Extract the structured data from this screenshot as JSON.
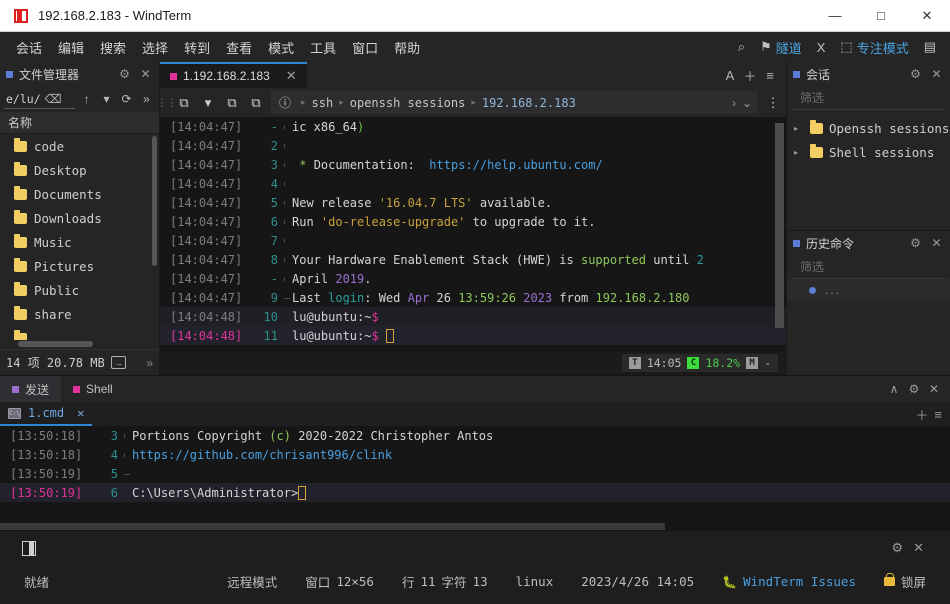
{
  "window": {
    "title": "192.168.2.183 - WindTerm",
    "minimize": "—",
    "maximize": "□",
    "close": "✕"
  },
  "menubar": {
    "items": [
      "会话",
      "编辑",
      "搜索",
      "选择",
      "转到",
      "查看",
      "模式",
      "工具",
      "窗口",
      "帮助"
    ],
    "right": {
      "search_icon": "⌕",
      "tunnel_icon": "⚑",
      "tunnel_label": "隧道",
      "x_label": "X",
      "focus_icon": "⬚",
      "focus_label": "专注模式",
      "layout_icon": "▤"
    }
  },
  "filemanager": {
    "title": "文件管理器",
    "gear_icon": "⚙",
    "close_icon": "✕",
    "path_value": "e/lu/",
    "clear_icon": "⌫",
    "up_icon": "↑",
    "dropdown_icon": "▾",
    "refresh_icon": "⟳",
    "more_icon": "»",
    "column_header": "名称",
    "items": [
      {
        "name": "code"
      },
      {
        "name": "Desktop"
      },
      {
        "name": "Documents"
      },
      {
        "name": "Downloads"
      },
      {
        "name": "Music"
      },
      {
        "name": "Pictures"
      },
      {
        "name": "Public"
      },
      {
        "name": "share"
      }
    ],
    "status": "14 项 20.78 MB",
    "transfer_icon": "→",
    "status_more": "»"
  },
  "terminal": {
    "tab": {
      "label": "1.192.168.2.183",
      "close_icon": "✕",
      "font_icon": "A",
      "add_icon": "＋",
      "menu_icon": "≡"
    },
    "toolbar": {
      "new_icon": "⧉",
      "dropdown_icon": "▾",
      "close_tab_icon": "⧉",
      "dup_icon": "⧉",
      "info_icon": "ⓘ",
      "crumbs": [
        "ssh",
        "openssh sessions",
        "192.168.2.183"
      ],
      "sep": "▸",
      "chevron_right": "›",
      "chevron_down": "⌄",
      "more_icon": "⋮"
    },
    "lines": [
      {
        "ts": "[14:04:47]",
        "ln": "-",
        "bar": "v",
        "spans": [
          {
            "t": "ic x86_64",
            "c": "c-white"
          },
          {
            "t": ")",
            "c": "c-green"
          }
        ]
      },
      {
        "ts": "[14:04:47]",
        "ln": "2",
        "bar": "v",
        "spans": []
      },
      {
        "ts": "[14:04:47]",
        "ln": "3",
        "bar": "v",
        "spans": [
          {
            "t": " ",
            "c": "c-white"
          },
          {
            "t": "*",
            "c": "c-lgreen"
          },
          {
            "t": " Documentation:  ",
            "c": "c-white"
          },
          {
            "t": "https://help.ubuntu.com/",
            "c": "c-blue"
          }
        ]
      },
      {
        "ts": "[14:04:47]",
        "ln": "4",
        "bar": "v",
        "spans": []
      },
      {
        "ts": "[14:04:47]",
        "ln": "5",
        "bar": "v",
        "spans": [
          {
            "t": "New release ",
            "c": "c-white"
          },
          {
            "t": "'16.04.7 LTS'",
            "c": "c-yellow"
          },
          {
            "t": " available.",
            "c": "c-white"
          }
        ]
      },
      {
        "ts": "[14:04:47]",
        "ln": "6",
        "bar": "v",
        "spans": [
          {
            "t": "Run ",
            "c": "c-white"
          },
          {
            "t": "'do-release-upgrade'",
            "c": "c-yellow"
          },
          {
            "t": " to upgrade to it.",
            "c": "c-white"
          }
        ]
      },
      {
        "ts": "[14:04:47]",
        "ln": "7",
        "bar": "v",
        "spans": []
      },
      {
        "ts": "[14:04:47]",
        "ln": "8",
        "bar": "v",
        "spans": [
          {
            "t": "Your Hardware Enablement Stack (HWE) is ",
            "c": "c-white"
          },
          {
            "t": "supported",
            "c": "c-lgreen"
          },
          {
            "t": " until ",
            "c": "c-white"
          },
          {
            "t": "2",
            "c": "c-cyan"
          }
        ]
      },
      {
        "ts": "[14:04:47]",
        "ln": "-",
        "bar": "v",
        "spans": [
          {
            "t": "April ",
            "c": "c-white"
          },
          {
            "t": "2019",
            "c": "c-purple"
          },
          {
            "t": ".",
            "c": "c-white"
          }
        ]
      },
      {
        "ts": "[14:04:47]",
        "ln": "9",
        "bar": "end",
        "spans": [
          {
            "t": "Last ",
            "c": "c-white"
          },
          {
            "t": "login",
            "c": "c-cyan"
          },
          {
            "t": ": Wed ",
            "c": "c-white"
          },
          {
            "t": "Apr",
            "c": "c-purple"
          },
          {
            "t": " 26 ",
            "c": "c-white"
          },
          {
            "t": "13:59:26",
            "c": "c-lgreen"
          },
          {
            "t": " ",
            "c": "c-white"
          },
          {
            "t": "2023",
            "c": "c-purple"
          },
          {
            "t": " from ",
            "c": "c-white"
          },
          {
            "t": "192.168.2.180",
            "c": "c-lgreen"
          }
        ]
      },
      {
        "ts": "[14:04:48]",
        "ln": "10",
        "bar": "",
        "state": "sel",
        "spans": [
          {
            "t": "lu@ubuntu:~",
            "c": "c-white"
          },
          {
            "t": "$",
            "c": "c-pink"
          }
        ]
      },
      {
        "ts": "[14:04:48]",
        "ln": "11",
        "bar": "",
        "state": "cur",
        "spans": [
          {
            "t": "lu@ubuntu:~",
            "c": "c-white"
          },
          {
            "t": "$ ",
            "c": "c-pink"
          }
        ],
        "cursor": true
      }
    ],
    "status": {
      "t_chip": "T",
      "time": "14:05",
      "c_chip": "C",
      "cpu": "18.2%",
      "m_chip": "M",
      "mem": "-"
    }
  },
  "sessions": {
    "title": "会话",
    "gear_icon": "⚙",
    "close_icon": "✕",
    "filter_placeholder": "筛选",
    "arrow_icon": "▸",
    "items": [
      {
        "name": "Openssh sessions"
      },
      {
        "name": "Shell sessions"
      }
    ]
  },
  "history": {
    "title": "历史命令",
    "gear_icon": "⚙",
    "close_icon": "✕",
    "filter_placeholder": "筛选",
    "entry": "..."
  },
  "bottom": {
    "tabs": [
      {
        "label": "发送",
        "color": "#9a6fd0",
        "active": true
      },
      {
        "label": "Shell",
        "color": "#e0339a",
        "active": false
      }
    ],
    "collapse_icon": "∧",
    "gear_icon": "⚙",
    "close_icon": "✕",
    "add_icon": "＋",
    "menu_icon": "≡",
    "subtab": {
      "label": "1.cmd",
      "icon_text": "C:\\",
      "close_icon": "✕"
    },
    "lines": [
      {
        "ts": "[13:50:18]",
        "ln": "3",
        "bar": "v",
        "spans": [
          {
            "t": "Portions Copyright ",
            "c": "c-white"
          },
          {
            "t": "(c)",
            "c": "c-lgreen"
          },
          {
            "t": " 2020-2022 Christopher Antos",
            "c": "c-white"
          }
        ]
      },
      {
        "ts": "[13:50:18]",
        "ln": "4",
        "bar": "v",
        "spans": [
          {
            "t": "https://github.com/chrisant996/clink",
            "c": "c-blue"
          }
        ]
      },
      {
        "ts": "[13:50:19]",
        "ln": "5",
        "bar": "end",
        "spans": []
      },
      {
        "ts": "[13:50:19]",
        "ln": "6",
        "bar": "",
        "state": "cur",
        "spans": [
          {
            "t": "C:\\Users\\Administrator>",
            "c": "c-white"
          }
        ],
        "cursor": true
      }
    ]
  },
  "statusarea": {
    "app_icon": "window-icon",
    "gear_icon": "⚙",
    "close_icon": "✕",
    "ready": "就绪",
    "mode": "远程模式",
    "window_label": "窗口",
    "window_size": "12×56",
    "row_label": "行",
    "row_value": "11",
    "col_label": "字符",
    "col_value": "13",
    "platform": "linux",
    "datetime": "2023/4/26 14:05",
    "issues": "WindTerm Issues",
    "lock": "锁屏"
  }
}
